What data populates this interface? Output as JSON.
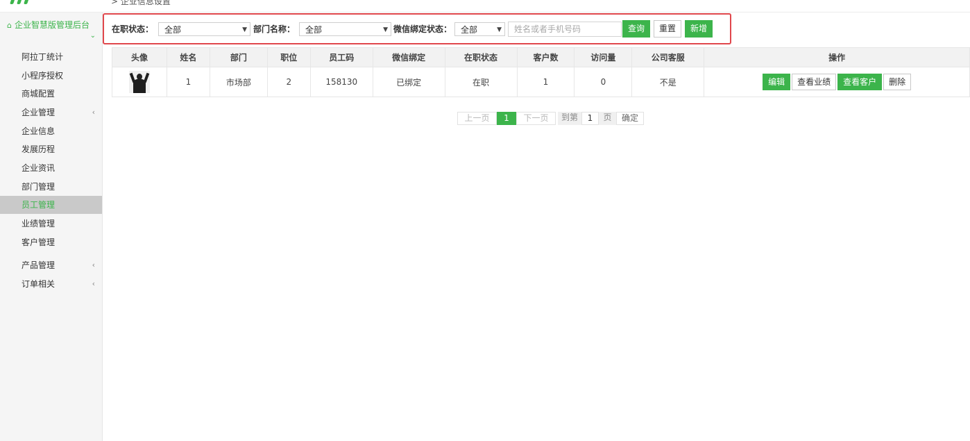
{
  "breadcrumb": "> 企业信息设置",
  "sidebar": {
    "title": "企业智慧版管理后台",
    "items": [
      {
        "label": "阿拉丁统计",
        "has_arrow": false
      },
      {
        "label": "小程序授权",
        "has_arrow": false
      },
      {
        "label": "商城配置",
        "has_arrow": false
      },
      {
        "label": "企业管理",
        "has_arrow": true
      },
      {
        "label": "企业信息",
        "has_arrow": false
      },
      {
        "label": "发展历程",
        "has_arrow": false
      },
      {
        "label": "企业资讯",
        "has_arrow": false
      },
      {
        "label": "部门管理",
        "has_arrow": false
      },
      {
        "label": "员工管理",
        "has_arrow": false,
        "active": true
      },
      {
        "label": "业绩管理",
        "has_arrow": false
      },
      {
        "label": "客户管理",
        "has_arrow": false
      },
      {
        "label": "产品管理",
        "has_arrow": true
      },
      {
        "label": "订单相关",
        "has_arrow": true
      }
    ]
  },
  "filters": {
    "status_label": "在职状态：",
    "status_value": "全部",
    "dept_label": "部门名称：",
    "dept_value": "全部",
    "wechat_label": "微信绑定状态：",
    "wechat_value": "全部",
    "search_placeholder": "姓名或者手机号码",
    "query_label": "查询",
    "reset_label": "重置",
    "add_label": "新增"
  },
  "table": {
    "headers": [
      "头像",
      "姓名",
      "部门",
      "职位",
      "员工码",
      "微信绑定",
      "在职状态",
      "客户数",
      "访问量",
      "公司客服",
      "操作"
    ],
    "rows": [
      {
        "name": "1",
        "dept": "市场部",
        "position": "2",
        "code": "158130",
        "wechat": "已绑定",
        "status": "在职",
        "customers": "1",
        "visits": "0",
        "service": "不是",
        "actions": {
          "edit": "编辑",
          "performance": "查看业绩",
          "customers": "查看客户",
          "delete": "删除"
        }
      }
    ]
  },
  "pagination": {
    "prev": "上一页",
    "current": "1",
    "next": "下一页",
    "goto": "到第",
    "page_input": "1",
    "page_unit": "页",
    "confirm": "确定"
  },
  "colors": {
    "accent": "#3cb44b",
    "highlight_border": "#e0474c"
  }
}
